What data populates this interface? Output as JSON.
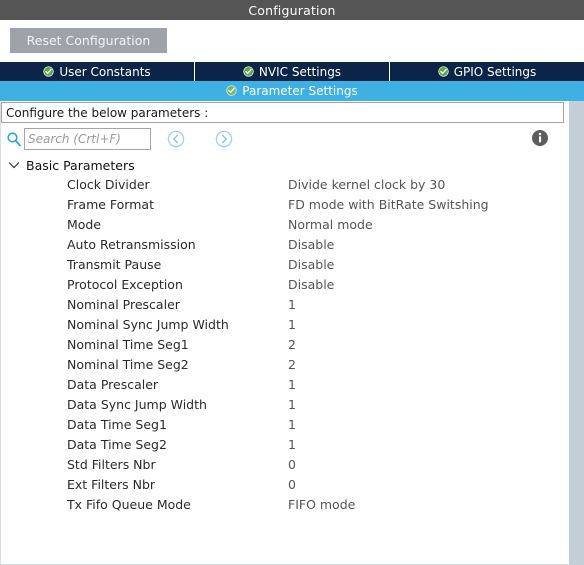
{
  "window": {
    "title": "Configuration"
  },
  "toolbar": {
    "reset_label": "Reset Configuration"
  },
  "tabs": {
    "row1": [
      {
        "label": "User Constants",
        "icon": "green-check-icon",
        "active": false
      },
      {
        "label": "NVIC Settings",
        "icon": "green-check-icon",
        "active": false
      },
      {
        "label": "GPIO Settings",
        "icon": "green-check-icon",
        "active": false
      }
    ],
    "row2": [
      {
        "label": "Parameter Settings",
        "icon": "green-check-icon",
        "active": true
      }
    ]
  },
  "panel": {
    "hint": "Configure the below parameters :",
    "search": {
      "value": "",
      "placeholder": "Search (Crtl+F)"
    },
    "nav": {
      "back_icon": "circle-chevron-left-icon",
      "forward_icon": "circle-chevron-right-icon"
    },
    "info_icon": "info-circle-icon"
  },
  "group": {
    "label": "Basic Parameters",
    "expanded": true,
    "chevron_icon": "chevron-down-icon"
  },
  "parameters": [
    {
      "name": "Clock Divider",
      "value": "Divide kernel clock by 30"
    },
    {
      "name": "Frame Format",
      "value": "FD mode with BitRate Switshing"
    },
    {
      "name": "Mode",
      "value": "Normal mode"
    },
    {
      "name": "Auto Retransmission",
      "value": "Disable"
    },
    {
      "name": "Transmit Pause",
      "value": "Disable"
    },
    {
      "name": "Protocol Exception",
      "value": "Disable"
    },
    {
      "name": "Nominal Prescaler",
      "value": "1"
    },
    {
      "name": "Nominal Sync Jump Width",
      "value": "1"
    },
    {
      "name": "Nominal Time Seg1",
      "value": "2"
    },
    {
      "name": "Nominal Time Seg2",
      "value": "2"
    },
    {
      "name": "Data Prescaler",
      "value": "1"
    },
    {
      "name": "Data Sync Jump Width",
      "value": "1"
    },
    {
      "name": "Data Time Seg1",
      "value": "1"
    },
    {
      "name": "Data Time Seg2",
      "value": "1"
    },
    {
      "name": "Std Filters Nbr",
      "value": "0"
    },
    {
      "name": "Ext Filters Nbr",
      "value": "0"
    },
    {
      "name": "Tx Fifo Queue Mode",
      "value": "FIFO mode"
    }
  ],
  "colors": {
    "titlebar_bg": "#555555",
    "tab_bg": "#0b2447",
    "tab_active_bg": "#3fb0e4",
    "check_green": "#5aab46",
    "accent_blue": "#3fb0e4",
    "scrollbar": "#c3ced6",
    "reset_button_bg": "#9da3a9"
  }
}
